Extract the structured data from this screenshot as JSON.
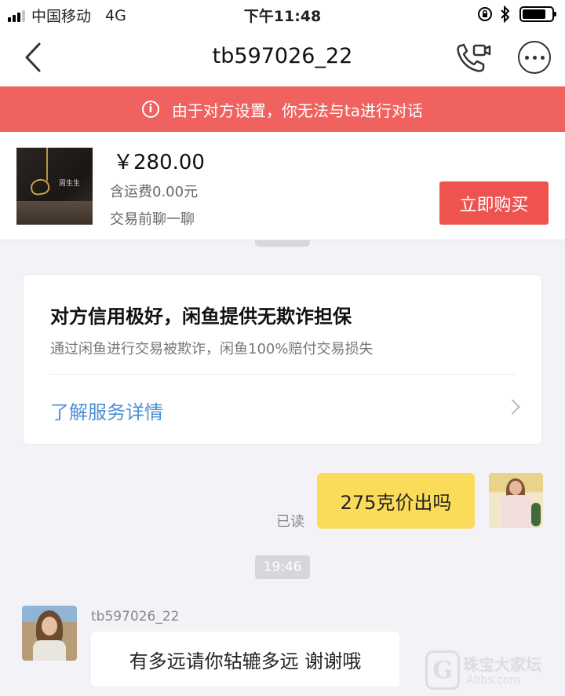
{
  "status_bar": {
    "carrier": "中国移动",
    "network": "4G",
    "time": "下午11:48",
    "signal_bars": 4,
    "signal_bars_active": 3,
    "battery_level": 0.8
  },
  "nav": {
    "title": "tb597026_22",
    "back_icon": "chevron-left-icon",
    "call_icon": "phone-video-icon",
    "more_icon": "more-icon"
  },
  "banner": {
    "icon": "info-icon",
    "icon_glyph": "i",
    "text": "由于对方设置，你无法与ta进行对话",
    "color": "#f0625f"
  },
  "product": {
    "price": "￥280.00",
    "shipping": "含运费0.00元",
    "note": "交易前聊一聊",
    "buy_label": "立即购买",
    "buy_color": "#ee5350"
  },
  "guarantee": {
    "title": "对方信用极好，闲鱼提供无欺诈担保",
    "subtitle": "通过闲鱼进行交易被欺诈，闲鱼100%赔付交易损失",
    "link_label": "了解服务详情",
    "link_color": "#4a8fd8"
  },
  "messages": {
    "outgoing": {
      "text": "275克价出吗",
      "read_status": "已读",
      "bubble_color": "#fbdb5a"
    },
    "time_divider": "19:46",
    "incoming": {
      "sender": "tb597026_22",
      "text": "有多远请你轱辘多远 谢谢哦"
    }
  },
  "watermark": {
    "logo": "G",
    "text": "珠宝大家坛",
    "url": "Abbs.com"
  }
}
